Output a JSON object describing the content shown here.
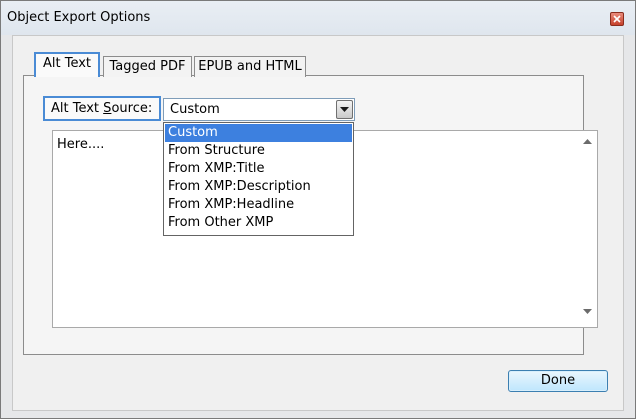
{
  "window": {
    "title": "Object Export Options"
  },
  "tabs": [
    {
      "label": "Alt Text",
      "active": true
    },
    {
      "label": "Tagged PDF",
      "active": false
    },
    {
      "label": "EPUB and HTML",
      "active": false
    }
  ],
  "alt_text": {
    "source_label_prefix": "Alt Text ",
    "source_label_mnemonic": "S",
    "source_label_suffix": "ource:",
    "source_value": "Custom",
    "text_value": "Here....",
    "dropdown_options": [
      "Custom",
      "From Structure",
      "From XMP:Title",
      "From XMP:Description",
      "From XMP:Headline",
      "From Other XMP"
    ],
    "selected_option_index": 0
  },
  "buttons": {
    "done_label": "Done"
  },
  "icons": {
    "close": "close-icon",
    "dropdown": "chevron-down-icon",
    "scroll_up": "scroll-up-arrow-icon",
    "scroll_down": "scroll-down-arrow-icon"
  },
  "colors": {
    "accent": "#3d80df",
    "focus_border": "#4a8bd5",
    "window_bg": "#e6e7e9",
    "close_red": "#c5412b"
  }
}
